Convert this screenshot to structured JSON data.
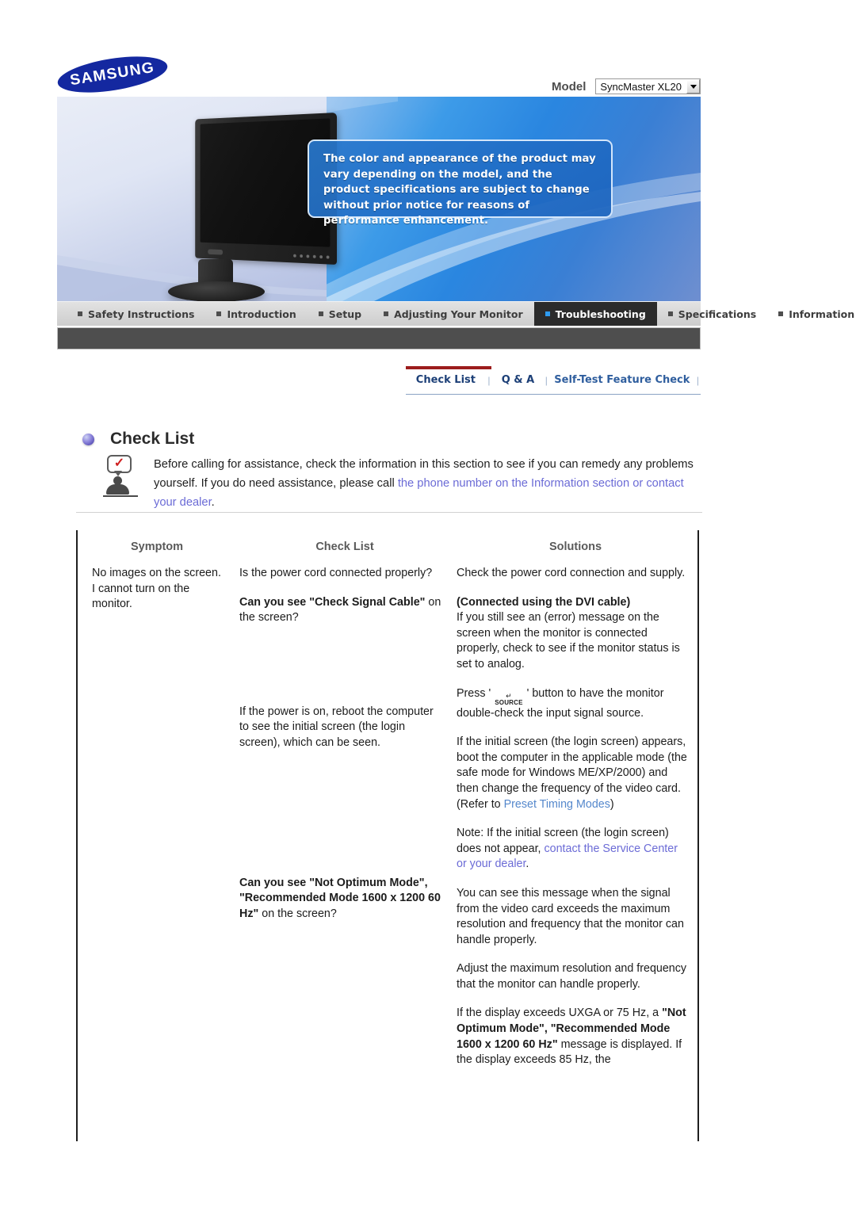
{
  "brand": {
    "logo_text": "SAMSUNG"
  },
  "model": {
    "label": "Model",
    "selected": "SyncMaster XL20",
    "dropdown_icon": "chevron-down-icon"
  },
  "banner": {
    "notice": "The color and appearance of the product may vary depending on the model, and the product specifications are subject to change without prior notice for reasons of performance enhancement.",
    "product_image_alt": "black widescreen lcd monitor"
  },
  "nav": {
    "items": [
      {
        "label": "Safety Instructions",
        "active": false
      },
      {
        "label": "Introduction",
        "active": false
      },
      {
        "label": "Setup",
        "active": false
      },
      {
        "label": "Adjusting Your Monitor",
        "active": false
      },
      {
        "label": "Troubleshooting",
        "active": true
      },
      {
        "label": "Specifications",
        "active": false
      },
      {
        "label": "Information",
        "active": false
      }
    ]
  },
  "subtabs": {
    "items": [
      {
        "label": "Check List",
        "active": true
      },
      {
        "label": "Q & A",
        "active": false
      },
      {
        "label": "Self-Test Feature Check",
        "active": false
      }
    ],
    "separator": "|"
  },
  "section": {
    "bullet_icon": "sphere-bullet-icon",
    "title": "Check List",
    "notice_icon": "person-with-checkmark-bubble-icon",
    "intro_part1": "Before calling for assistance, check the information in this section to see if you can remedy any problems yourself. If you do need assistance, please call ",
    "intro_link": "the phone number on the Information section or contact your dealer",
    "intro_part2": "."
  },
  "table": {
    "headers": [
      "Symptom",
      "Check List",
      "Solutions"
    ],
    "rows": [
      {
        "symptom": "No images on the screen. I cannot turn on the monitor.",
        "checklist": [
          {
            "text": "Is the power cord connected properly?"
          },
          {
            "bold_lead": "Can you see \"Check Signal Cable\"",
            "text": " on the screen?"
          },
          {
            "text": "If the power is on, reboot the computer to see the initial screen (the login screen), which can be seen."
          },
          {
            "bold_lead": "Can you see \"Not Optimum Mode\", \"Recommended Mode 1600 x 1200 60 Hz\"",
            "text": " on the screen?"
          }
        ],
        "solutions": [
          {
            "text": "Check the power cord connection and supply."
          },
          {
            "bold_head": "(Connected using the DVI cable)",
            "text": "If you still see an (error) message on the screen when the monitor is connected properly, check to see if the monitor status is set to analog."
          },
          {
            "text_pre": "Press ' ",
            "button_icon": "source-button-icon",
            "button_label": "SOURCE",
            "text_post": " ' button to have the monitor double-check the input signal source."
          },
          {
            "text": "If the initial screen (the login screen) appears, boot the computer in the applicable mode (the safe mode for Windows ME/XP/2000) and then change the frequency of the video card.",
            "refer_pre": "(Refer to ",
            "refer_link": "Preset Timing Modes",
            "refer_post": ")"
          },
          {
            "note_pre": "Note: If the initial screen (the login screen) does not appear, ",
            "note_link": "contact the Service Center or your dealer",
            "note_post": "."
          },
          {
            "text": "You can see this message when the signal from the video card exceeds the maximum resolution and frequency that the monitor can handle properly."
          },
          {
            "text": "Adjust the maximum resolution and frequency that the monitor can handle properly."
          },
          {
            "text_pre2": "If the display exceeds UXGA or 75 Hz, a ",
            "bold_mid": "\"Not Optimum Mode\", \"Recommended Mode 1600 x 1200 60 Hz\"",
            "text_post2": " message is displayed. If the display exceeds 85 Hz, the"
          }
        ]
      }
    ]
  }
}
